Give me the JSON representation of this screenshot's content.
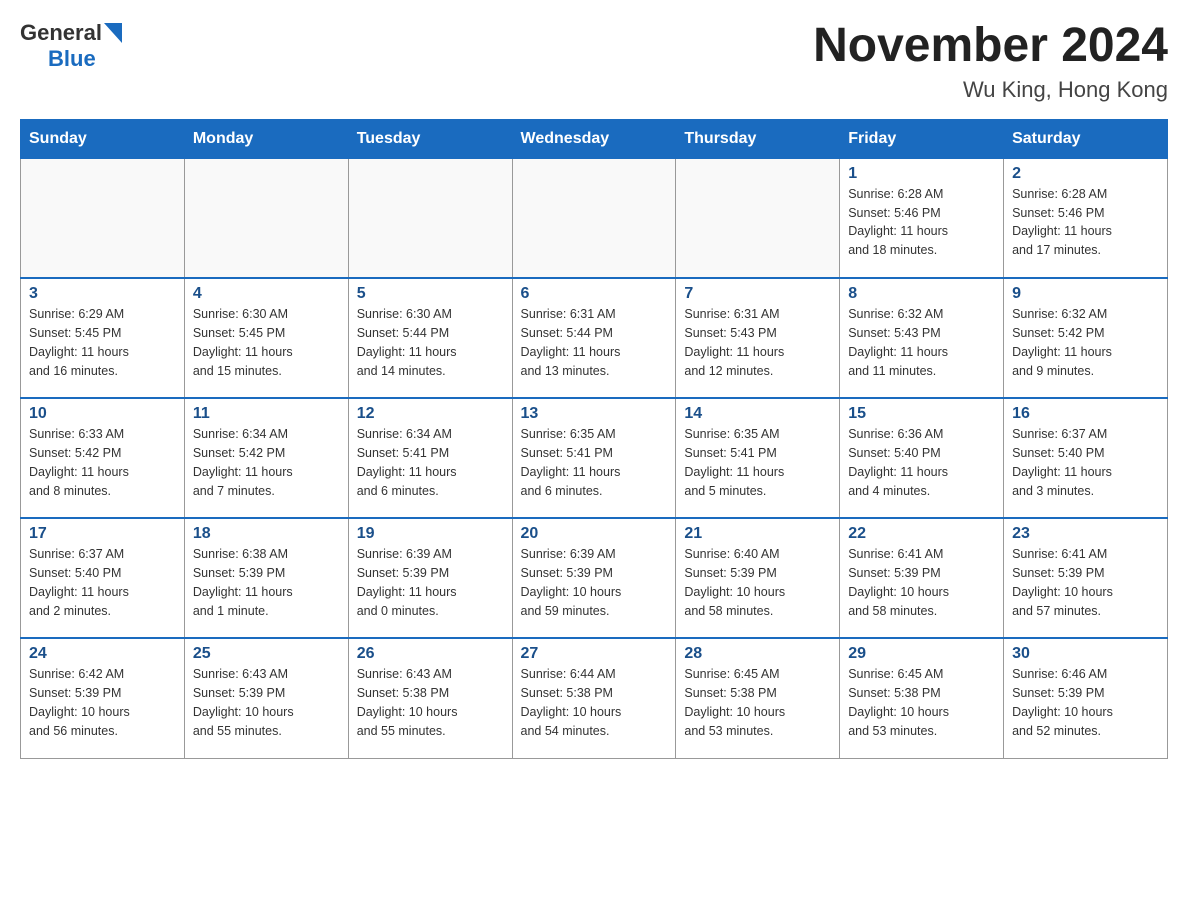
{
  "header": {
    "logo_general": "General",
    "logo_blue": "Blue",
    "month_title": "November 2024",
    "location": "Wu King, Hong Kong"
  },
  "days_of_week": [
    "Sunday",
    "Monday",
    "Tuesday",
    "Wednesday",
    "Thursday",
    "Friday",
    "Saturday"
  ],
  "weeks": [
    [
      {
        "day": "",
        "info": ""
      },
      {
        "day": "",
        "info": ""
      },
      {
        "day": "",
        "info": ""
      },
      {
        "day": "",
        "info": ""
      },
      {
        "day": "",
        "info": ""
      },
      {
        "day": "1",
        "info": "Sunrise: 6:28 AM\nSunset: 5:46 PM\nDaylight: 11 hours\nand 18 minutes."
      },
      {
        "day": "2",
        "info": "Sunrise: 6:28 AM\nSunset: 5:46 PM\nDaylight: 11 hours\nand 17 minutes."
      }
    ],
    [
      {
        "day": "3",
        "info": "Sunrise: 6:29 AM\nSunset: 5:45 PM\nDaylight: 11 hours\nand 16 minutes."
      },
      {
        "day": "4",
        "info": "Sunrise: 6:30 AM\nSunset: 5:45 PM\nDaylight: 11 hours\nand 15 minutes."
      },
      {
        "day": "5",
        "info": "Sunrise: 6:30 AM\nSunset: 5:44 PM\nDaylight: 11 hours\nand 14 minutes."
      },
      {
        "day": "6",
        "info": "Sunrise: 6:31 AM\nSunset: 5:44 PM\nDaylight: 11 hours\nand 13 minutes."
      },
      {
        "day": "7",
        "info": "Sunrise: 6:31 AM\nSunset: 5:43 PM\nDaylight: 11 hours\nand 12 minutes."
      },
      {
        "day": "8",
        "info": "Sunrise: 6:32 AM\nSunset: 5:43 PM\nDaylight: 11 hours\nand 11 minutes."
      },
      {
        "day": "9",
        "info": "Sunrise: 6:32 AM\nSunset: 5:42 PM\nDaylight: 11 hours\nand 9 minutes."
      }
    ],
    [
      {
        "day": "10",
        "info": "Sunrise: 6:33 AM\nSunset: 5:42 PM\nDaylight: 11 hours\nand 8 minutes."
      },
      {
        "day": "11",
        "info": "Sunrise: 6:34 AM\nSunset: 5:42 PM\nDaylight: 11 hours\nand 7 minutes."
      },
      {
        "day": "12",
        "info": "Sunrise: 6:34 AM\nSunset: 5:41 PM\nDaylight: 11 hours\nand 6 minutes."
      },
      {
        "day": "13",
        "info": "Sunrise: 6:35 AM\nSunset: 5:41 PM\nDaylight: 11 hours\nand 6 minutes."
      },
      {
        "day": "14",
        "info": "Sunrise: 6:35 AM\nSunset: 5:41 PM\nDaylight: 11 hours\nand 5 minutes."
      },
      {
        "day": "15",
        "info": "Sunrise: 6:36 AM\nSunset: 5:40 PM\nDaylight: 11 hours\nand 4 minutes."
      },
      {
        "day": "16",
        "info": "Sunrise: 6:37 AM\nSunset: 5:40 PM\nDaylight: 11 hours\nand 3 minutes."
      }
    ],
    [
      {
        "day": "17",
        "info": "Sunrise: 6:37 AM\nSunset: 5:40 PM\nDaylight: 11 hours\nand 2 minutes."
      },
      {
        "day": "18",
        "info": "Sunrise: 6:38 AM\nSunset: 5:39 PM\nDaylight: 11 hours\nand 1 minute."
      },
      {
        "day": "19",
        "info": "Sunrise: 6:39 AM\nSunset: 5:39 PM\nDaylight: 11 hours\nand 0 minutes."
      },
      {
        "day": "20",
        "info": "Sunrise: 6:39 AM\nSunset: 5:39 PM\nDaylight: 10 hours\nand 59 minutes."
      },
      {
        "day": "21",
        "info": "Sunrise: 6:40 AM\nSunset: 5:39 PM\nDaylight: 10 hours\nand 58 minutes."
      },
      {
        "day": "22",
        "info": "Sunrise: 6:41 AM\nSunset: 5:39 PM\nDaylight: 10 hours\nand 58 minutes."
      },
      {
        "day": "23",
        "info": "Sunrise: 6:41 AM\nSunset: 5:39 PM\nDaylight: 10 hours\nand 57 minutes."
      }
    ],
    [
      {
        "day": "24",
        "info": "Sunrise: 6:42 AM\nSunset: 5:39 PM\nDaylight: 10 hours\nand 56 minutes."
      },
      {
        "day": "25",
        "info": "Sunrise: 6:43 AM\nSunset: 5:39 PM\nDaylight: 10 hours\nand 55 minutes."
      },
      {
        "day": "26",
        "info": "Sunrise: 6:43 AM\nSunset: 5:38 PM\nDaylight: 10 hours\nand 55 minutes."
      },
      {
        "day": "27",
        "info": "Sunrise: 6:44 AM\nSunset: 5:38 PM\nDaylight: 10 hours\nand 54 minutes."
      },
      {
        "day": "28",
        "info": "Sunrise: 6:45 AM\nSunset: 5:38 PM\nDaylight: 10 hours\nand 53 minutes."
      },
      {
        "day": "29",
        "info": "Sunrise: 6:45 AM\nSunset: 5:38 PM\nDaylight: 10 hours\nand 53 minutes."
      },
      {
        "day": "30",
        "info": "Sunrise: 6:46 AM\nSunset: 5:39 PM\nDaylight: 10 hours\nand 52 minutes."
      }
    ]
  ]
}
